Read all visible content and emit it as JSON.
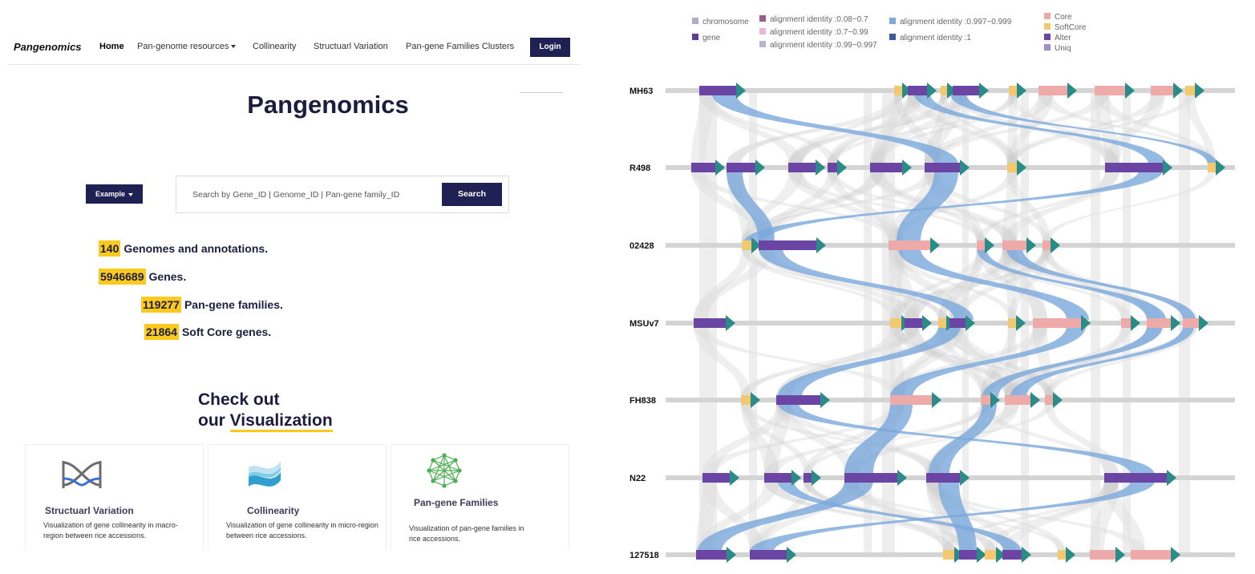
{
  "nav": {
    "brand": "Pangenomics",
    "items": [
      {
        "label": "Home",
        "active": true
      },
      {
        "label": "Pan-genome resources",
        "dropdown": true
      },
      {
        "label": "Collinearity"
      },
      {
        "label": "Structuarl Variation"
      },
      {
        "label": "Pan-gene Families Clusters"
      }
    ],
    "login_label": "Login"
  },
  "hero": {
    "title": "Pangenomics"
  },
  "search": {
    "example_label": "Example",
    "placeholder": "Search by Gene_ID | Genome_ID | Pan-gene family_ID",
    "button_label": "Search"
  },
  "stats": [
    {
      "value": "140",
      "label": "Genomes and annotations."
    },
    {
      "value": "5946689",
      "label": "Genes."
    },
    {
      "value": "119277",
      "label": "Pan-gene families."
    },
    {
      "value": "21864",
      "label": "Soft Core genes."
    }
  ],
  "viz_heading": {
    "line1": "Check out",
    "line2_prefix": "our ",
    "line2_highlight": "Visualization"
  },
  "cards": [
    {
      "title": "Structuarl Variation",
      "desc": "Visualization of gene collinearity in macro-region between rice accessions.",
      "icon": "structural-variation-icon"
    },
    {
      "title": "Collinearity",
      "desc": "Visualization of gene collinearity in micro-region between rice accessions.",
      "icon": "collinearity-icon"
    },
    {
      "title": "Pan-gene Families",
      "desc": "Visualization of pan-gene families in rice accessions.",
      "icon": "network-icon"
    }
  ],
  "colors": {
    "navy": "#1f2054",
    "highlight": "#fcc91f",
    "chromosome": "#b4a9cd",
    "gene": "#5d3d9a",
    "core": "#eea9a9",
    "softcore": "#f3c86f",
    "alter": "#6a45a4",
    "uniq": "#a08fc6",
    "identity_low": "#9b5b8c",
    "identity_mid": "#eab8d6",
    "identity_high": "#b9b4d6",
    "identity_very_high": "#7ea9dc",
    "identity_one": "#3d5aa0",
    "arrow": "#2a8c86",
    "track": "#d4d4d4",
    "link_gray": "#8a8a8a",
    "link_blue": "#79a8dc"
  },
  "legend": {
    "col1": [
      {
        "label": "chromosome",
        "color_key": "chromosome"
      },
      {
        "label": "gene",
        "color_key": "gene"
      }
    ],
    "col2": [
      {
        "label": "alignment identity :0.08~0.7",
        "color_key": "identity_low"
      },
      {
        "label": "alignment identity :0.7~0.99",
        "color_key": "identity_mid"
      },
      {
        "label": "alignment identity :0.99~0.997",
        "color_key": "identity_high"
      }
    ],
    "col3": [
      {
        "label": "alignment identity :0.997~0.999",
        "color_key": "identity_very_high"
      },
      {
        "label": "alignment identity :1",
        "color_key": "identity_one"
      }
    ],
    "col4": [
      {
        "label": "Core",
        "color_key": "core"
      },
      {
        "label": "SoftCore",
        "color_key": "softcore"
      },
      {
        "label": "Alter",
        "color_key": "alter"
      },
      {
        "label": "Uniq",
        "color_key": "uniq"
      }
    ]
  },
  "collinearity": {
    "accessions": [
      "MH63",
      "R498",
      "02428",
      "MSUv7",
      "FH838",
      "N22",
      "127518"
    ]
  }
}
